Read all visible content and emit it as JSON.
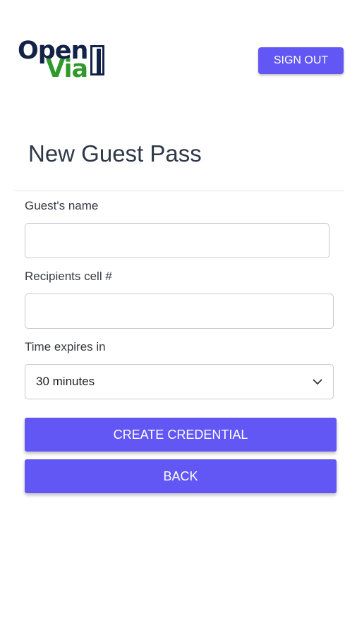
{
  "brand": {
    "line1": "Open",
    "line2": "Via"
  },
  "header": {
    "signout_label": "SIGN OUT"
  },
  "page": {
    "title": "New Guest Pass"
  },
  "form": {
    "guest_name": {
      "label": "Guest's name",
      "value": "",
      "placeholder": ""
    },
    "recipient_cell": {
      "label": "Recipients cell #",
      "value": "",
      "placeholder": ""
    },
    "expires": {
      "label": "Time expires in",
      "selected": "30 minutes"
    }
  },
  "actions": {
    "create_label": "CREATE CREDENTIAL",
    "back_label": "BACK"
  },
  "colors": {
    "accent": "#6257f4",
    "brand_dark": "#132247",
    "brand_green": "#2f9a2b"
  }
}
